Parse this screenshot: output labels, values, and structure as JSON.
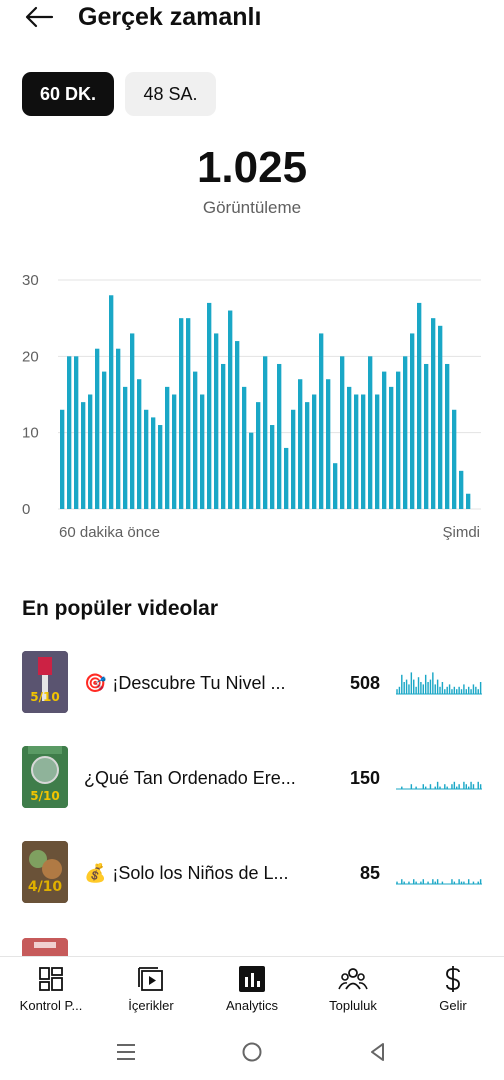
{
  "header": {
    "title": "Gerçek zamanlı",
    "back_icon": "arrow-left-icon"
  },
  "range_tabs": [
    {
      "label": "60 DK.",
      "active": true
    },
    {
      "label": "48 SA.",
      "active": false
    }
  ],
  "summary": {
    "value": "1.025",
    "label": "Görüntüleme"
  },
  "chart_data": {
    "type": "bar",
    "color": "#1aa7c6",
    "ylim": [
      0,
      30
    ],
    "yticks": [
      "0",
      "10",
      "20",
      "30"
    ],
    "x_start_label": "60 dakika önce",
    "x_end_label": "Şimdi",
    "values": [
      13,
      20,
      20,
      14,
      15,
      21,
      18,
      28,
      21,
      16,
      23,
      17,
      13,
      12,
      11,
      16,
      15,
      25,
      25,
      18,
      15,
      27,
      23,
      19,
      26,
      22,
      16,
      10,
      14,
      20,
      11,
      19,
      8,
      13,
      17,
      14,
      15,
      23,
      17,
      6,
      20,
      16,
      15,
      15,
      20,
      15,
      18,
      16,
      18,
      20,
      23,
      27,
      19,
      25,
      24,
      19,
      13,
      5,
      2
    ],
    "grid": true
  },
  "top_videos": {
    "title": "En popüler videolar",
    "items": [
      {
        "emoji": "🎯",
        "title": "¡Descubre Tu Nivel ...",
        "views": "508",
        "thumb_color": "#3b3550",
        "spark": [
          2,
          3,
          8,
          5,
          6,
          4,
          9,
          6,
          3,
          7,
          5,
          4,
          8,
          5,
          6,
          9,
          4,
          6,
          3,
          5,
          2,
          3,
          4,
          2,
          3,
          2,
          3,
          2,
          4,
          2,
          3,
          2,
          4,
          3,
          2,
          5
        ]
      },
      {
        "emoji": "",
        "title": "¿Qué Tan Ordenado Ere...",
        "views": "150",
        "thumb_color": "#2f6b3a",
        "spark": [
          0,
          0,
          1,
          0,
          0,
          0,
          2,
          0,
          1,
          0,
          0,
          2,
          1,
          0,
          2,
          0,
          1,
          3,
          1,
          0,
          2,
          1,
          0,
          2,
          3,
          1,
          2,
          0,
          3,
          2,
          1,
          3,
          2,
          0,
          3,
          2
        ]
      },
      {
        "emoji": "💰",
        "title": "¡Solo los Niños de L...",
        "views": "85",
        "thumb_color": "#4a3a2c",
        "spark": [
          1,
          0,
          2,
          1,
          0,
          1,
          0,
          2,
          1,
          0,
          1,
          2,
          0,
          1,
          0,
          2,
          1,
          2,
          0,
          1,
          0,
          0,
          0,
          2,
          1,
          0,
          2,
          1,
          1,
          0,
          2,
          0,
          1,
          0,
          1,
          2
        ]
      }
    ]
  },
  "bottom_nav": [
    {
      "label": "Kontrol P...",
      "icon": "dashboard-icon"
    },
    {
      "label": "İçerikler",
      "icon": "content-play-icon"
    },
    {
      "label": "Analytics",
      "icon": "analytics-icon",
      "active": true
    },
    {
      "label": "Topluluk",
      "icon": "community-icon"
    },
    {
      "label": "Gelir",
      "icon": "dollar-icon"
    }
  ],
  "system_nav": [
    "menu-icon",
    "home-circle-icon",
    "back-triangle-icon"
  ]
}
